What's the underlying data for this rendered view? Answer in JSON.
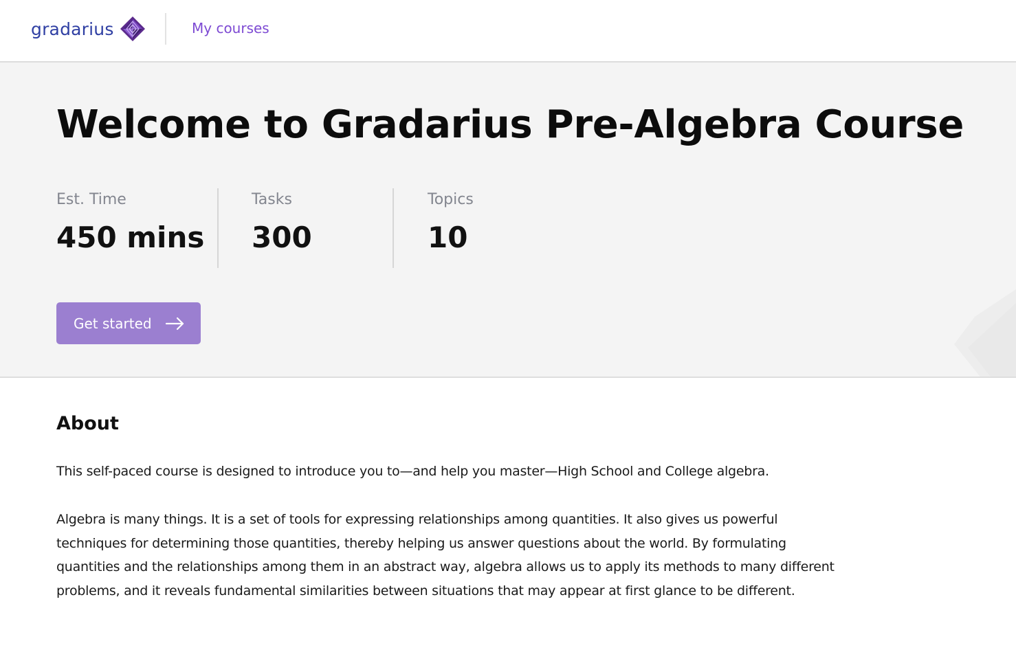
{
  "header": {
    "logo_text": "gradarius",
    "nav_link": "My courses"
  },
  "hero": {
    "title": "Welcome to Gradarius Pre-Algebra Course",
    "stats": [
      {
        "label": "Est. Time",
        "value": "450 mins"
      },
      {
        "label": "Tasks",
        "value": "300"
      },
      {
        "label": "Topics",
        "value": "10"
      }
    ],
    "cta_label": "Get started"
  },
  "about": {
    "heading": "About",
    "paragraphs": [
      "This self-paced course is designed to introduce you to—and help you master—High School and College algebra.",
      "Algebra is many things. It is a set of tools for expressing relationships among quantities. It also gives us powerful techniques for determining those quantities, thereby helping us answer questions about the world. By formulating quantities and the relationships among them in an abstract way, algebra allows us to apply its methods to many different problems, and it reveals fundamental similarities between situations that may appear at first glance to be different."
    ]
  },
  "colors": {
    "brand_blue": "#2f3fa3",
    "accent_purple": "#7d4ad3",
    "button_purple": "#9b7fd0",
    "hero_background": "#f4f4f4"
  },
  "icons": [
    "gradarius-logo-icon",
    "arrow-right-icon"
  ]
}
